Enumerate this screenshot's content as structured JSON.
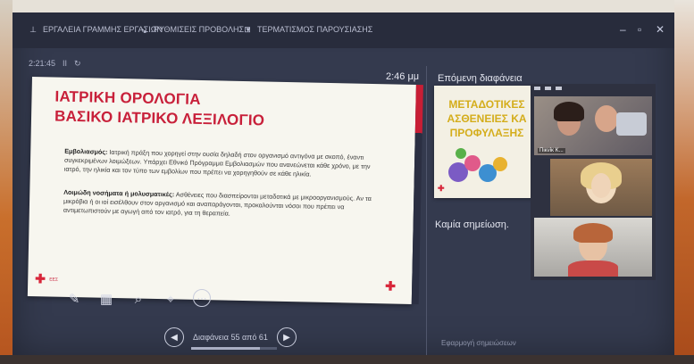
{
  "titlebar": {
    "items": [
      "ΕΡΓΑΛΕΙΑ ΓΡΑΜΜΗΣ ΕΡΓΑΣΙΩΝ",
      "ΡΥΘΜΙΣΕΙΣ ΠΡΟΒΟΛΗΣ ▾",
      "ΤΕΡΜΑΤΙΣΜΟΣ ΠΑΡΟΥΣΙΑΣΗΣ"
    ],
    "min_glyph": "–",
    "max_glyph": "▫",
    "close_glyph": "✕"
  },
  "timer": {
    "elapsed": "2:21:45",
    "pause_glyph": "II",
    "reset_glyph": "↻"
  },
  "clock": "2:46 μμ",
  "slide": {
    "title_line1": "ΙΑΤΡΙΚΗ ΟΡΟΛΟΓΙΑ",
    "title_line2": "ΒΑΣΙΚΟ ΙΑΤΡΙΚΟ ΛΕΞΙΛΟΓΙΟ",
    "p1_term": "Εμβολιασμός:",
    "p1_text": "Ιατρική πράξη που χορηγεί στην ουσία δηλαδή στον οργανισμό αντιγόνα με σκοπό, έναντι συγκεκριμένων λοιμώξεων. Υπάρχει Εθνικό Πρόγραμμα Εμβολιασμών που ανανεώνεται κάθε χρόνο, με την ιατρό, την ηλικία και τον τύπο των εμβολίων που πρέπει να χορηγηθούν σε κάθε ηλικία.",
    "p2_term": "Λοιμώδη νοσήματα ή μολυσματικές:",
    "p2_text": "Ασθένειες που διασπείρονται μεταδοτικά με μικροοργανισμούς. Αν τα μικρόβια ή οι ιοί εισέλθουν στον οργανισμό και αναπαράγονται, προκαλούνται νόσοι που πρέπει να αντιμετωπιστούν με αγωγή από τον ιατρό, για τη θεραπεία.",
    "logo_text": "ΕΕΣ"
  },
  "toolbar": {
    "pen": "✎",
    "grid": "▦",
    "search": "⌕",
    "pointer": "⌖",
    "more": "⋯"
  },
  "nav": {
    "prev": "◀",
    "next": "▶",
    "label": "Διαφάνεια 55 από 61"
  },
  "next_slide": {
    "heading": "Επόμενη διαφάνεια",
    "line1": "ΜΕΤΑΔΟΤΙΚΕΣ",
    "line2": "ΑΣΘΕΝΕΙΕΣ ΚΑ",
    "line3": "ΠΡΟΦΥΛΑΞΗΣ"
  },
  "notes": "Καμία σημείωση.",
  "footer": "Εφαρμογή σημειώσεων",
  "video": {
    "participants": [
      {
        "name": "Πικνίκ Κ..."
      },
      {
        "name": ""
      },
      {
        "name": ""
      }
    ]
  }
}
